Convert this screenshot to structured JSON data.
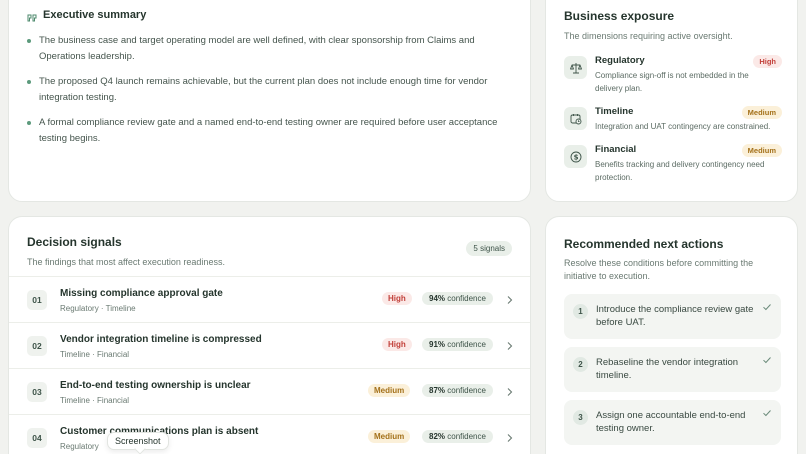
{
  "summary": {
    "title": "Executive summary",
    "bullets": [
      "The business case and target operating model are well defined, with clear sponsorship from Claims and Operations leadership.",
      "The proposed Q4 launch remains achievable, but the current plan does not include enough time for vendor integration testing.",
      "A formal compliance review gate and a named end-to-end testing owner are required before user acceptance testing begins."
    ]
  },
  "exposure": {
    "title": "Business exposure",
    "subtitle": "The dimensions requiring active oversight.",
    "items": [
      {
        "name": "Regulatory",
        "badge": "High",
        "desc": "Compliance sign-off is not embedded in the delivery plan."
      },
      {
        "name": "Timeline",
        "badge": "Medium",
        "desc": "Integration and UAT contingency are constrained."
      },
      {
        "name": "Financial",
        "badge": "Medium",
        "desc": "Benefits tracking and delivery contingency need protection."
      }
    ]
  },
  "signals": {
    "title": "Decision signals",
    "subtitle": "The findings that most affect execution readiness.",
    "count": "5 signals",
    "confidence_suffix": "confidence",
    "rows": [
      {
        "num": "01",
        "title": "Missing compliance approval gate",
        "tags": "Regulatory · Timeline",
        "severity": "High",
        "confidence": "94%"
      },
      {
        "num": "02",
        "title": "Vendor integration timeline is compressed",
        "tags": "Timeline · Financial",
        "severity": "High",
        "confidence": "91%"
      },
      {
        "num": "03",
        "title": "End-to-end testing ownership is unclear",
        "tags": "Timeline · Financial",
        "severity": "Medium",
        "confidence": "87%"
      },
      {
        "num": "04",
        "title": "Customer communications plan is absent",
        "tags": "Regulatory",
        "severity": "Medium",
        "confidence": "82%"
      }
    ]
  },
  "actions": {
    "title": "Recommended next actions",
    "subtitle": "Resolve these conditions before committing the initiative to execution.",
    "items": [
      {
        "num": "1",
        "text": "Introduce the compliance review gate before UAT."
      },
      {
        "num": "2",
        "text": "Rebaseline the vendor integration timeline."
      },
      {
        "num": "3",
        "text": "Assign one accountable end-to-end testing owner."
      }
    ]
  },
  "tooltip": {
    "text": "Screenshot"
  },
  "colors": {
    "accent": "#5c9a7c",
    "high": "#c2403a",
    "medium": "#a4711a"
  }
}
